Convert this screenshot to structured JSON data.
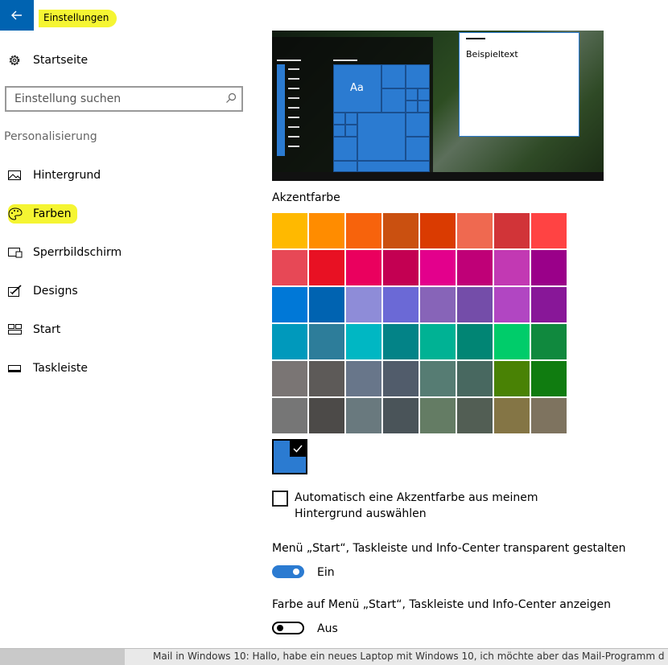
{
  "header": {
    "title": "Einstellungen",
    "back_icon": "arrow-left-icon"
  },
  "sidebar": {
    "home": {
      "label": "Startseite",
      "icon": "gear-icon"
    },
    "search": {
      "placeholder": "Einstellung suchen",
      "icon": "search-icon"
    },
    "section_title": "Personalisierung",
    "items": [
      {
        "label": "Hintergrund",
        "icon": "picture-icon"
      },
      {
        "label": "Farben",
        "icon": "palette-icon",
        "selected": true
      },
      {
        "label": "Sperrbildschirm",
        "icon": "lock-screen-icon"
      },
      {
        "label": "Designs",
        "icon": "brush-icon"
      },
      {
        "label": "Start",
        "icon": "start-tiles-icon"
      },
      {
        "label": "Taskleiste",
        "icon": "taskbar-icon"
      }
    ]
  },
  "main": {
    "preview": {
      "sample_text": "Beispieltext",
      "tile_label": "Aa"
    },
    "accent_title": "Akzentfarbe",
    "accent_colors": [
      "#FFB900",
      "#FF8C00",
      "#F7630C",
      "#CA5010",
      "#DA3B01",
      "#EF6950",
      "#D13438",
      "#FF4343",
      "#E74856",
      "#E81123",
      "#EA005E",
      "#C30052",
      "#E3008C",
      "#BF0077",
      "#C239B3",
      "#9A0089",
      "#0078D7",
      "#0063B1",
      "#8E8CD8",
      "#6B69D6",
      "#8764B8",
      "#744DA9",
      "#B146C2",
      "#881798",
      "#0099BC",
      "#2D7D9A",
      "#00B7C3",
      "#038387",
      "#00B294",
      "#018574",
      "#00CC6A",
      "#10893E",
      "#7A7574",
      "#5D5A58",
      "#68768A",
      "#515C6B",
      "#567C73",
      "#486860",
      "#498205",
      "#107C10",
      "#767676",
      "#4C4A48",
      "#69797E",
      "#4A5459",
      "#647C64",
      "#525E54",
      "#847545",
      "#7E735F"
    ],
    "custom_color": "#2B7BD1",
    "auto_accent": {
      "label": "Automatisch eine Akzentfarbe aus meinem Hintergrund auswählen",
      "checked": false
    },
    "transparency": {
      "title": "Menü „Start“, Taskleiste und Info-Center transparent gestalten",
      "state": "Ein",
      "on": true
    },
    "show_color": {
      "title": "Farbe auf Menü „Start“, Taskleiste und Info-Center anzeigen",
      "state": "Aus",
      "on": false
    }
  },
  "background_window": {
    "text": "Mail in Windows 10: Hallo, habe ein neues Laptop mit Windows 10, ich möchte aber das Mail-Programm d"
  },
  "colors": {
    "accent": "#0063B1",
    "highlight": "#F5F532"
  }
}
